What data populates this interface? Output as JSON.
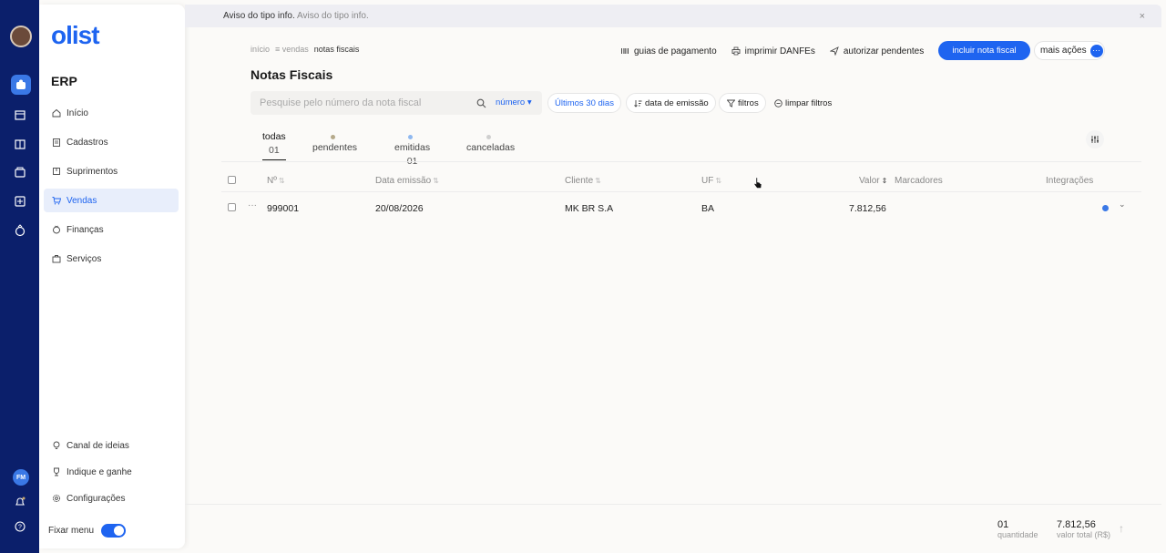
{
  "notice": {
    "label": "Aviso do tipo info.",
    "message": "Aviso do tipo info.",
    "close": "×"
  },
  "sidebar": {
    "logo": "olist",
    "section": "ERP",
    "items": [
      {
        "label": "Início",
        "icon": "home-icon"
      },
      {
        "label": "Cadastros",
        "icon": "clipboard-icon"
      },
      {
        "label": "Suprimentos",
        "icon": "box-icon"
      },
      {
        "label": "Vendas",
        "icon": "cart-icon",
        "active": true
      },
      {
        "label": "Finanças",
        "icon": "money-icon"
      },
      {
        "label": "Serviços",
        "icon": "briefcase-icon"
      }
    ],
    "bottom": [
      {
        "label": "Canal de ideias",
        "icon": "lightbulb-icon"
      },
      {
        "label": "Indique e ganhe",
        "icon": "trophy-icon"
      },
      {
        "label": "Configurações",
        "icon": "gear-icon"
      }
    ],
    "pin_label": "Fixar menu",
    "pin_on": true
  },
  "rail": {
    "user_initials": "FM"
  },
  "breadcrumb": {
    "home": "início",
    "sales": "≡ vendas",
    "current": "notas fiscais"
  },
  "page_title": "Notas Fiscais",
  "toolbar": {
    "payment_guides": "guias de pagamento",
    "print_danfes": "imprimir DANFEs",
    "authorize": "autorizar pendentes",
    "primary": "incluir nota fiscal",
    "more": "mais ações",
    "more_dots": "···"
  },
  "search": {
    "placeholder": "Pesquise pelo número da nota fiscal",
    "value": "",
    "field": "número ▾"
  },
  "filters": {
    "period": "Últimos 30 dias",
    "sort": "data de emissão",
    "filters": "filtros",
    "clear": "limpar filtros"
  },
  "tabs": [
    {
      "label": "todas",
      "count": "01",
      "active": true,
      "dot": ""
    },
    {
      "label": "pendentes",
      "count": "",
      "dot": "#b5a98a"
    },
    {
      "label": "emitidas",
      "count": "01",
      "dot": "#8fb8f0"
    },
    {
      "label": "canceladas",
      "count": "",
      "dot": "#cfcfcf"
    }
  ],
  "table": {
    "columns": {
      "number": "Nº",
      "date": "Data emissão",
      "client": "Cliente",
      "uf": "UF",
      "value": "Valor",
      "value_sort": "⇕",
      "markers": "Marcadores",
      "integrations": "Integrações"
    },
    "sort_icon": "⇅",
    "rows": [
      {
        "menu": "···",
        "number": "999001",
        "date": "20/08/2026",
        "client": "MK BR S.A",
        "uf": "BA",
        "value": "7.812,56",
        "markers": "",
        "integration_color": "#3a78e6",
        "expand": "⌄"
      }
    ]
  },
  "footer": {
    "quantity": "01",
    "quantity_label": "quantidade",
    "total": "7.812,56",
    "total_label": "valor total (R$)",
    "up": "↑"
  }
}
